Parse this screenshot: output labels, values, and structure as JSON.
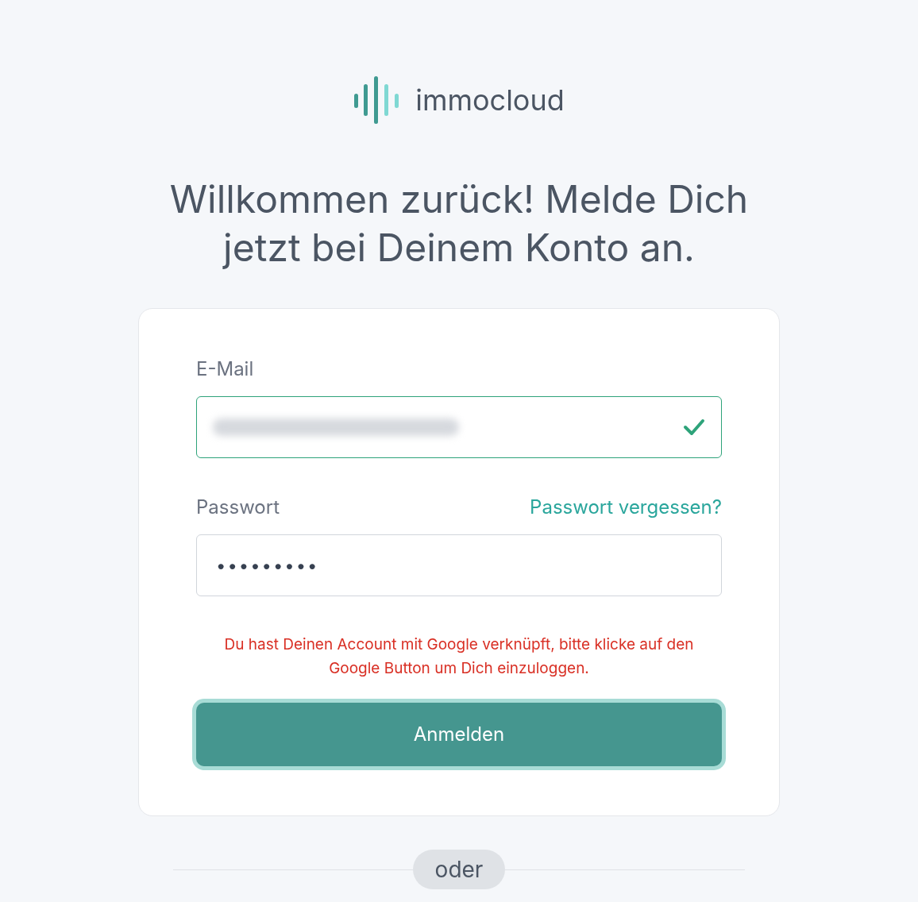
{
  "logo": {
    "name": "immocloud"
  },
  "heading": "Willkommen zurück! Melde Dich jetzt bei Deinem Konto an.",
  "email": {
    "label": "E-Mail",
    "valid": true,
    "redacted": true
  },
  "password": {
    "label": "Passwort",
    "forgot_link": "Passwort vergessen?",
    "value": "•••••••••"
  },
  "error": "Du hast Deinen Account mit Google verknüpft, bitte klicke auf den Google Button um Dich einzuloggen.",
  "submit": {
    "label": "Anmelden",
    "focused": true
  },
  "divider": "oder"
}
